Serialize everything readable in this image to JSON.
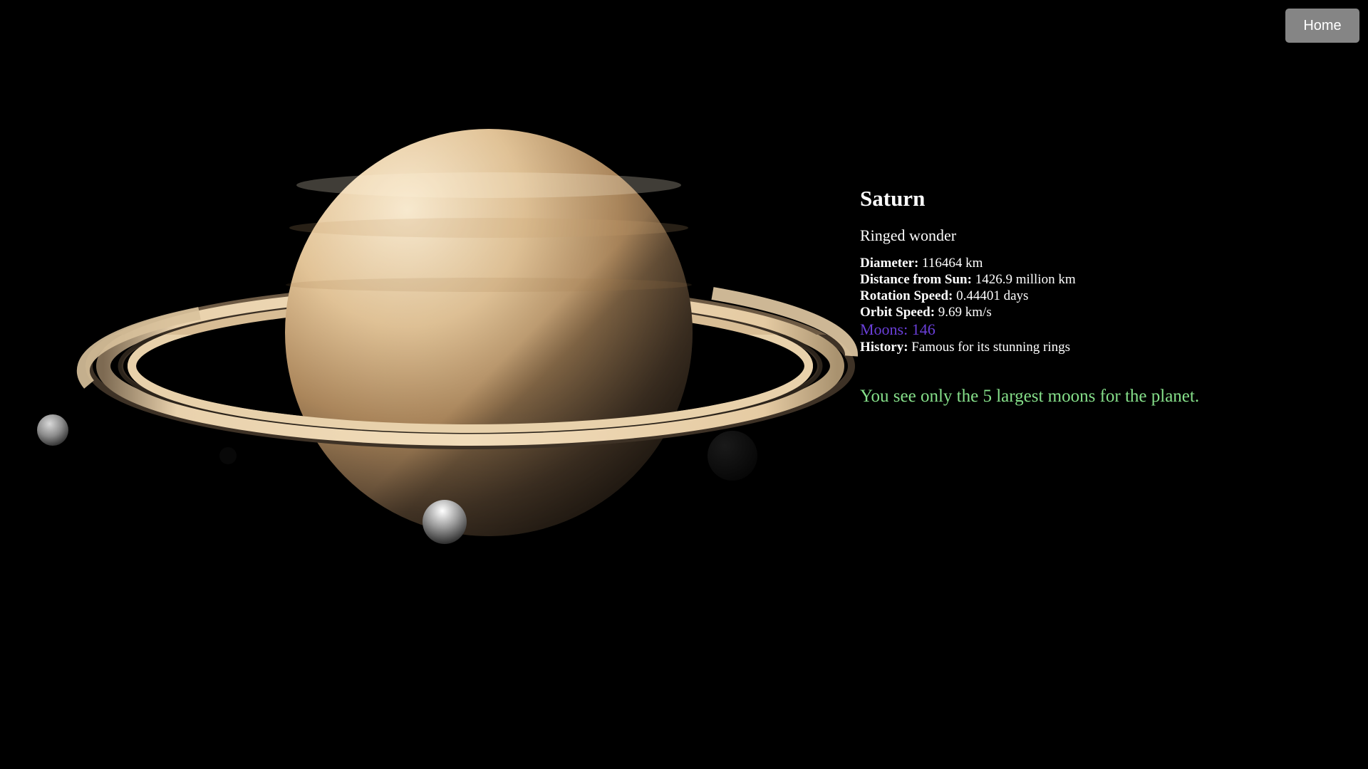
{
  "header": {
    "home_label": "Home"
  },
  "planet": {
    "name": "Saturn",
    "tagline": "Ringed wonder",
    "facts": {
      "diameter_label": "Diameter:",
      "diameter_value": " 116464 km",
      "distance_label": "Distance from Sun:",
      "distance_value": " 1426.9 million km",
      "rotation_label": "Rotation Speed:",
      "rotation_value": " 0.44401 days",
      "orbit_label": "Orbit Speed:",
      "orbit_value": " 9.69 km/s",
      "moons_text": "Moons: 146",
      "history_label": "History:",
      "history_value": " Famous for its stunning rings"
    },
    "moons_note": "You see only the 5 largest moons for the planet."
  },
  "colors": {
    "background": "#000000",
    "home_button": "#858585",
    "moons_text": "#6a3fd9",
    "moons_note": "#86e08a",
    "planet_light": "#f6e3c2",
    "planet_dark": "#2a2018",
    "ring": "#e6cba3"
  },
  "icons": {
    "planet": "saturn-planet",
    "moon": "moon-sphere"
  }
}
